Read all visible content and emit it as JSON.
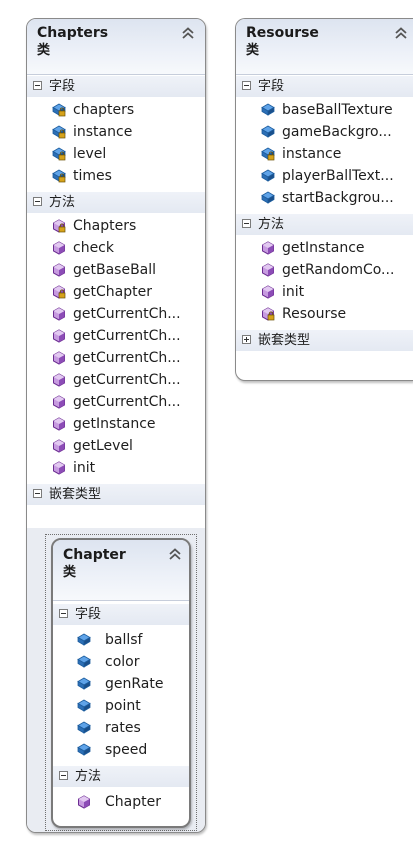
{
  "colors": {
    "field_icon": "#2e6db1",
    "method_icon": "#7a3da0",
    "header_bg": "#dde4f0",
    "section_bg": "#e6eaf2"
  },
  "chapters": {
    "title": "Chapters",
    "kind": "类",
    "fields_label": "字段",
    "fields": [
      {
        "name": "chapters",
        "icon": "private-field-icon"
      },
      {
        "name": "instance",
        "icon": "private-field-icon"
      },
      {
        "name": "level",
        "icon": "private-field-icon"
      },
      {
        "name": "times",
        "icon": "private-field-icon"
      }
    ],
    "methods_label": "方法",
    "methods": [
      {
        "name": "Chapters",
        "icon": "private-method-icon"
      },
      {
        "name": "check",
        "icon": "method-icon"
      },
      {
        "name": "getBaseBall",
        "icon": "method-icon"
      },
      {
        "name": "getChapter",
        "icon": "private-method-icon"
      },
      {
        "name": "getCurrentCh...",
        "icon": "method-icon"
      },
      {
        "name": "getCurrentCh...",
        "icon": "method-icon"
      },
      {
        "name": "getCurrentCh...",
        "icon": "method-icon"
      },
      {
        "name": "getCurrentCh...",
        "icon": "method-icon"
      },
      {
        "name": "getCurrentCh...",
        "icon": "method-icon"
      },
      {
        "name": "getInstance",
        "icon": "method-icon"
      },
      {
        "name": "getLevel",
        "icon": "method-icon"
      },
      {
        "name": "init",
        "icon": "method-icon"
      }
    ],
    "nested_label": "嵌套类型"
  },
  "chapter": {
    "title": "Chapter",
    "kind": "类",
    "fields_label": "字段",
    "fields": [
      {
        "name": "ballsf",
        "icon": "field-icon"
      },
      {
        "name": "color",
        "icon": "field-icon"
      },
      {
        "name": "genRate",
        "icon": "field-icon"
      },
      {
        "name": "point",
        "icon": "field-icon"
      },
      {
        "name": "rates",
        "icon": "field-icon"
      },
      {
        "name": "speed",
        "icon": "field-icon"
      }
    ],
    "methods_label": "方法",
    "methods": [
      {
        "name": "Chapter",
        "icon": "method-icon"
      }
    ]
  },
  "resourse": {
    "title": "Resourse",
    "kind": "类",
    "fields_label": "字段",
    "fields": [
      {
        "name": "baseBallTexture",
        "icon": "field-icon"
      },
      {
        "name": "gameBackgro...",
        "icon": "field-icon"
      },
      {
        "name": "instance",
        "icon": "private-field-icon"
      },
      {
        "name": "playerBallText...",
        "icon": "field-icon"
      },
      {
        "name": "startBackgrou...",
        "icon": "field-icon"
      }
    ],
    "methods_label": "方法",
    "methods": [
      {
        "name": "getInstance",
        "icon": "method-icon"
      },
      {
        "name": "getRandomCo...",
        "icon": "method-icon"
      },
      {
        "name": "init",
        "icon": "method-icon"
      },
      {
        "name": "Resourse",
        "icon": "private-method-icon"
      }
    ],
    "nested_label": "嵌套类型"
  }
}
